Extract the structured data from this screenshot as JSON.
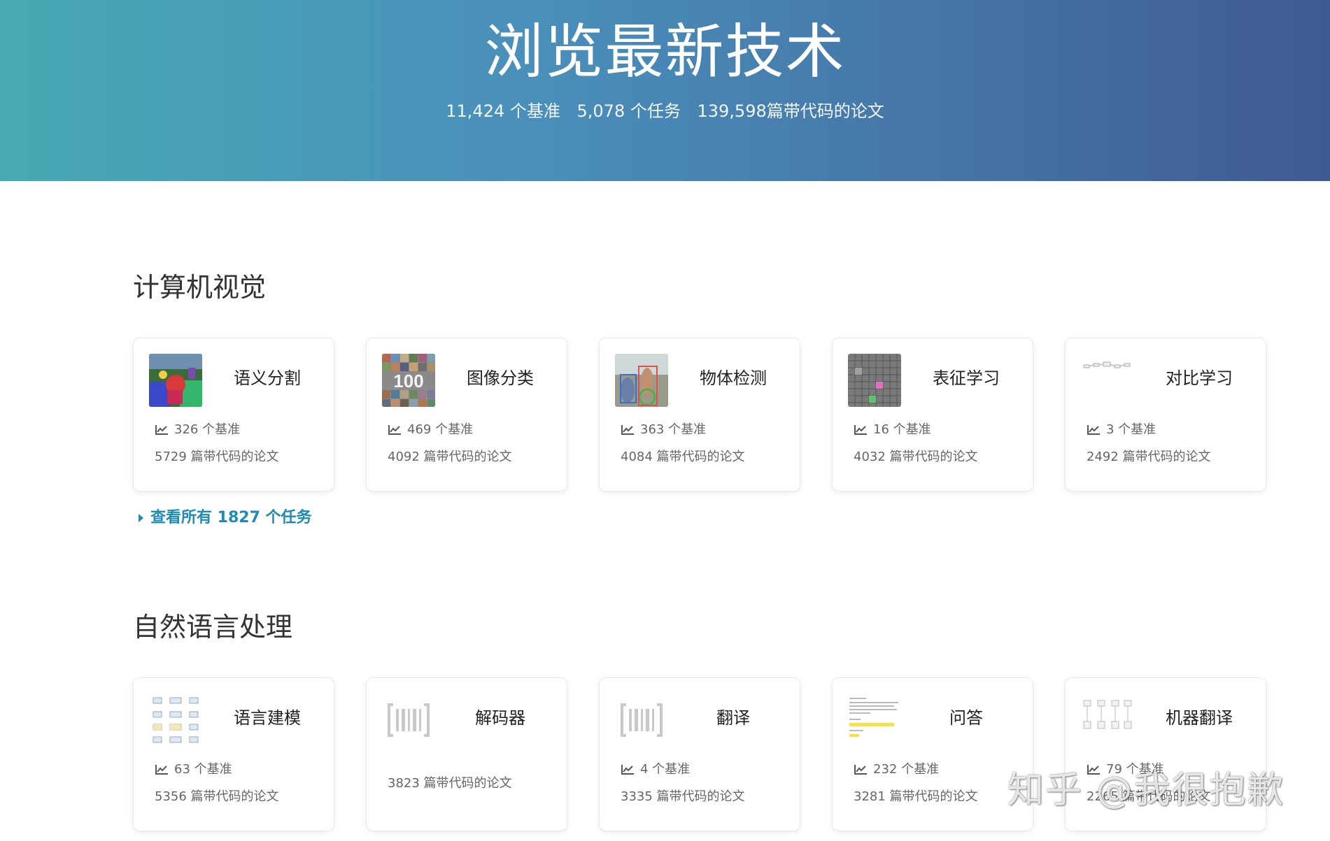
{
  "hero": {
    "title": "浏览最新技术",
    "stats": [
      "11,424 个基准",
      "5,078 个任务",
      "139,598篇带代码的论文"
    ]
  },
  "sections": [
    {
      "title": "计算机视觉",
      "cards": [
        {
          "title": "语义分割",
          "benchmarks": "326 个基准",
          "papers": "5729 篇带代码的论文",
          "thumb": "segmentation-thumb"
        },
        {
          "title": "图像分类",
          "benchmarks": "469 个基准",
          "papers": "4092 篇带代码的论文",
          "thumb": "classification-thumb"
        },
        {
          "title": "物体检测",
          "benchmarks": "363 个基准",
          "papers": "4084 篇带代码的论文",
          "thumb": "detection-thumb"
        },
        {
          "title": "表征学习",
          "benchmarks": "16 个基准",
          "papers": "4032 篇带代码的论文",
          "thumb": "representation-thumb"
        },
        {
          "title": "对比学习",
          "benchmarks": "3 个基准",
          "papers": "2492 篇带代码的论文",
          "thumb": "contrastive-thumb"
        }
      ],
      "see_all": "查看所有 1827 个任务"
    },
    {
      "title": "自然语言处理",
      "cards": [
        {
          "title": "语言建模",
          "benchmarks": "63 个基准",
          "papers": "5356 篇带代码的论文",
          "thumb": "language-model-thumb"
        },
        {
          "title": "解码器",
          "benchmarks": "",
          "papers": "3823 篇带代码的论文",
          "thumb": "placeholder-bracket-icon"
        },
        {
          "title": "翻译",
          "benchmarks": "4 个基准",
          "papers": "3335 篇带代码的论文",
          "thumb": "placeholder-bracket-icon"
        },
        {
          "title": "问答",
          "benchmarks": "232 个基准",
          "papers": "3281 篇带代码的论文",
          "thumb": "qa-thumb"
        },
        {
          "title": "机器翻译",
          "benchmarks": "79 个基准",
          "papers": "2265 篇带代码的论文",
          "thumb": "machine-translation-thumb"
        }
      ]
    }
  ],
  "watermark": "知乎 @我很抱歉",
  "colors": {
    "link": "#1f8ab3",
    "hero_start": "#47aab3",
    "hero_end": "#3f5a92"
  }
}
